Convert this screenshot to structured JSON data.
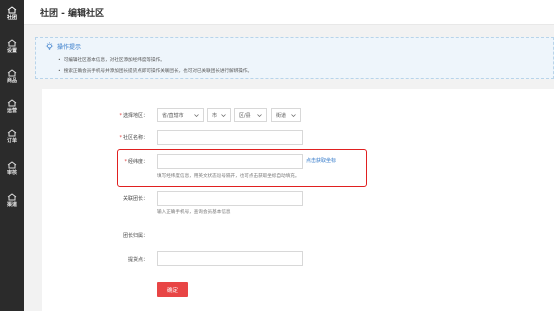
{
  "sidebar": {
    "items": [
      {
        "label": "社团",
        "icon": "home-icon",
        "active": true
      },
      {
        "label": "设置",
        "icon": "home-icon",
        "active": false
      },
      {
        "label": "商品",
        "icon": "home-icon",
        "active": false
      },
      {
        "label": "运营",
        "icon": "home-icon",
        "active": false
      },
      {
        "label": "订单",
        "icon": "home-icon",
        "active": false
      },
      {
        "label": "审核",
        "icon": "home-icon",
        "active": false
      },
      {
        "label": "渠道",
        "icon": "home-icon",
        "active": false
      }
    ]
  },
  "header": {
    "title": "社团 - 编辑社区"
  },
  "tips": {
    "title": "操作提示",
    "items": [
      "可编辑社区基本信息，对社区添加经纬度等操作。",
      "搜索正确会员手机号并添加团长提货点即可操作关联团长，也可对已关联团长进行解绑操作。"
    ]
  },
  "form": {
    "region_label": "选择地区：",
    "province": "省/直辖市",
    "city": "市",
    "district": "区/县",
    "street": "街道",
    "name_label": "社区名称：",
    "name_value": "",
    "lnglat_label": "经纬度：",
    "lnglat_value": "",
    "lnglat_link": "点击获取坐标",
    "lnglat_hint": "填写经纬度信息，用英文状态逗号隔开，也可点击获取坐标自动填充。",
    "leader_label": "关联团长：",
    "leader_value": "",
    "leader_hint": "输入正确手机号，查询会员基本信息",
    "leader_belong_label": "团长归属：",
    "pickup_label": "提货点：",
    "pickup_value": "",
    "submit_label": "确定"
  },
  "colors": {
    "sidebar_bg": "#2b2b2b",
    "accent_blue": "#2f77c9",
    "submit_red": "#e84545",
    "highlight_red": "#e02020"
  }
}
